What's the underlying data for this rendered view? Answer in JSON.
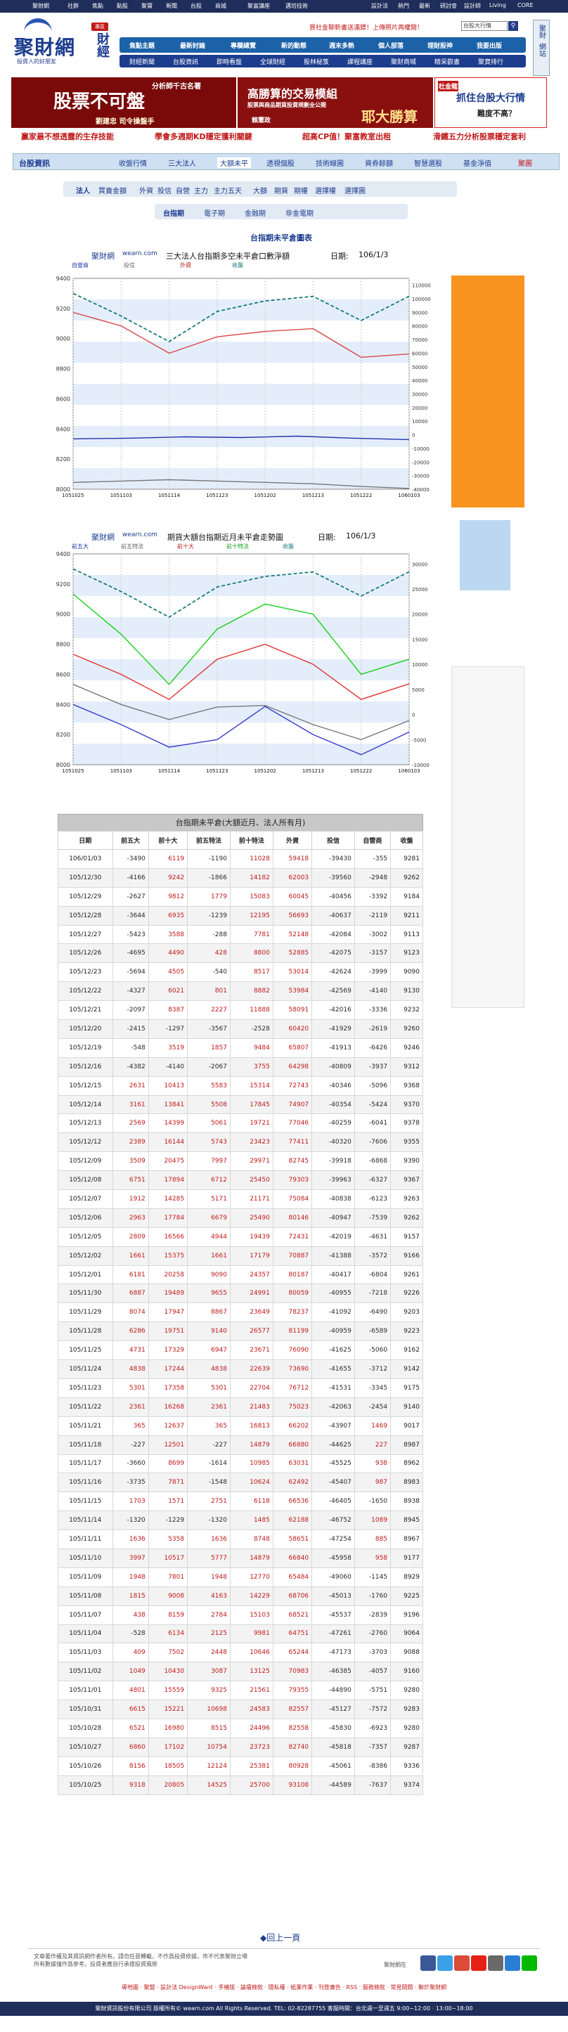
{
  "topnav": [
    "聚財網",
    "社群",
    "焦點",
    "點股",
    "聚寶",
    "新聞",
    "台股",
    "商城",
    "聚富講座",
    "邁培技術",
    "",
    "",
    "設計法",
    "熱門",
    "最新",
    "研討會",
    "設計師",
    "Living",
    "CORE"
  ],
  "logo": {
    "main": "聚財網",
    "side": "財經",
    "sub": "投資人的好朋友"
  },
  "pill": "專區",
  "promo": "買社金聊新書送滿鏢！上傳照片再權閱！",
  "search_placeholder": "台股大行情",
  "search_icon": "search-icon",
  "nav1": [
    "焦點主題",
    "最新討論",
    "專欄總覽",
    "新的動態",
    "週末多熱",
    "個人部落",
    "理財股神",
    "我要出版"
  ],
  "nav2": [
    "財經新聞",
    "台股資訊",
    "即時看盤",
    "全球財經",
    "股林秘笈",
    "課程講座",
    "聚財商城",
    "精采叡書",
    "聚寶排行"
  ],
  "side_right": [
    "聚財",
    "網站"
  ],
  "banner1": {
    "a": "股票不可盤",
    "b": "分析師千古名著",
    "c": "劉建忠 司令操盤手"
  },
  "banner2": {
    "a": "高勝算的交易模組",
    "b": "股票與商品期貨投資規劃全公開",
    "c": "耶大勝算",
    "d": "賴憲政"
  },
  "banner3": {
    "a": "杜金龍",
    "b": "抓住台股大行情",
    "c": "難度不高？"
  },
  "promo_row": [
    "贏家最不想透露的生存技能",
    "學會多週期KD穩定獲利關鍵",
    "超高CP值！聚富教室出租",
    "滑鐵五力分析股票穩定套利"
  ],
  "tabs": [
    "台股資訊",
    "收盤行情",
    "三大法人",
    "大額未平",
    "透視個股",
    "技術線圖",
    "資券餘額",
    "智慧選股",
    "基金淨值",
    "聚圖"
  ],
  "sub1": [
    "法人",
    "買賣金額",
    "外資",
    "投信",
    "自營",
    "主力",
    "主力五天",
    "大額",
    "期貨",
    "期權",
    "選擇權",
    "選擇圖"
  ],
  "sub2": [
    "台指期",
    "電子期",
    "金融期",
    "非金電期"
  ],
  "page_title": "台指期未平倉圖表",
  "chart1": {
    "site": "聚財網",
    "url": "wearn.com",
    "title": "三大法人台指期多空未平倉口數淨額",
    "date_label": "日期:",
    "date": "106/1/3",
    "legend": [
      "自營商",
      "投信",
      "外資",
      "收盤"
    ]
  },
  "chart2": {
    "site": "聚財網",
    "url": "wearn.com",
    "title": "期貨大額台指期近月未平倉走勢圖",
    "date_label": "日期:",
    "date": "106/1/3",
    "legend": [
      "前五大",
      "前五特法",
      "前十大",
      "前十特法",
      "收盤"
    ]
  },
  "chart_data": [
    {
      "type": "line",
      "title": "三大法人台指期多空未平倉口數淨額",
      "x": [
        "1051025",
        "1051103",
        "1051114",
        "1051123",
        "1051202",
        "1051213",
        "1051222",
        "1060103"
      ],
      "ylim": [
        8000,
        9400
      ],
      "y2lim": [
        -40000,
        115000
      ],
      "series": [
        {
          "name": "自營商",
          "values": [
            -3000,
            -2500,
            -1500,
            -2000,
            -1000,
            -2500,
            -3500
          ]
        },
        {
          "name": "投信",
          "values": [
            -35000,
            -34000,
            -33000,
            -34000,
            -35000,
            -36000,
            -38000,
            -39430
          ]
        },
        {
          "name": "外資",
          "values": [
            90000,
            80000,
            60000,
            72000,
            76000,
            78000,
            57000,
            59418
          ]
        },
        {
          "name": "收盤",
          "values": [
            9300,
            9150,
            8980,
            9180,
            9250,
            9280,
            9120,
            9281
          ]
        }
      ]
    },
    {
      "type": "line",
      "title": "期貨大額台指期近月未平倉走勢圖",
      "x": [
        "1051025",
        "1051103",
        "1051114",
        "1051123",
        "1051202",
        "1051213",
        "1051222",
        "1060103"
      ],
      "ylim": [
        8000,
        9400
      ],
      "y2lim": [
        -10000,
        32000
      ],
      "series": [
        {
          "name": "前五大",
          "values": [
            2000,
            -2000,
            -6500,
            -5000,
            1600,
            -4000,
            -8000,
            -3490
          ]
        },
        {
          "name": "前五特法",
          "values": [
            6000,
            2000,
            -1000,
            1500,
            1800,
            -2000,
            -5000,
            -1190
          ]
        },
        {
          "name": "前十大",
          "values": [
            12000,
            8000,
            3000,
            11000,
            14000,
            10000,
            3000,
            6119
          ]
        },
        {
          "name": "前十特法",
          "values": [
            24000,
            16000,
            6000,
            17000,
            22000,
            20000,
            8000,
            11028
          ]
        },
        {
          "name": "收盤",
          "values": [
            9300,
            9150,
            8980,
            9180,
            9250,
            9280,
            9120,
            9281
          ]
        }
      ]
    }
  ],
  "table": {
    "caption": "台指期未平倉(大額近月、法人所有月)",
    "headers": [
      "日期",
      "前五大",
      "前十大",
      "前五特法",
      "前十特法",
      "外資",
      "投信",
      "自營商",
      "收盤"
    ],
    "rows": [
      [
        "106/01/03",
        "-3490",
        "6119",
        "-1190",
        "11028",
        "59418",
        "-39430",
        "-355",
        "9281"
      ],
      [
        "105/12/30",
        "-4166",
        "9242",
        "-1866",
        "14182",
        "62003",
        "-39560",
        "-2948",
        "9262"
      ],
      [
        "105/12/29",
        "-2627",
        "9812",
        "1779",
        "15083",
        "60045",
        "-40456",
        "-3392",
        "9184"
      ],
      [
        "105/12/28",
        "-3644",
        "6935",
        "-1239",
        "12195",
        "56693",
        "-40637",
        "-2119",
        "9211"
      ],
      [
        "105/12/27",
        "-5423",
        "3588",
        "-288",
        "7781",
        "52148",
        "-42084",
        "-3002",
        "9113"
      ],
      [
        "105/12/26",
        "-4695",
        "4490",
        "428",
        "8800",
        "52885",
        "-42075",
        "-3157",
        "9123"
      ],
      [
        "105/12/23",
        "-5694",
        "4505",
        "-540",
        "8517",
        "53014",
        "-42624",
        "-3999",
        "9090"
      ],
      [
        "105/12/22",
        "-4327",
        "6021",
        "801",
        "8882",
        "53984",
        "-42569",
        "-4140",
        "9130"
      ],
      [
        "105/12/21",
        "-2097",
        "8387",
        "2227",
        "11888",
        "58091",
        "-42016",
        "-3336",
        "9232"
      ],
      [
        "105/12/20",
        "-2415",
        "-1297",
        "-3567",
        "-2528",
        "60420",
        "-41929",
        "-2619",
        "9260"
      ],
      [
        "105/12/19",
        "-548",
        "3519",
        "1857",
        "9484",
        "65807",
        "-41913",
        "-6426",
        "9246"
      ],
      [
        "105/12/16",
        "-4382",
        "-4140",
        "-2067",
        "3755",
        "64298",
        "-40809",
        "-3937",
        "9312"
      ],
      [
        "105/12/15",
        "2631",
        "10413",
        "5583",
        "15314",
        "72743",
        "-40346",
        "-5096",
        "9368"
      ],
      [
        "105/12/14",
        "3161",
        "13841",
        "5508",
        "17845",
        "74907",
        "-40354",
        "-5424",
        "9370"
      ],
      [
        "105/12/13",
        "2569",
        "14399",
        "5061",
        "19721",
        "77046",
        "-40259",
        "-6041",
        "9378"
      ],
      [
        "105/12/12",
        "2389",
        "16144",
        "5743",
        "23423",
        "77411",
        "-40320",
        "-7606",
        "9355"
      ],
      [
        "105/12/09",
        "3509",
        "20475",
        "7997",
        "29971",
        "82745",
        "-39918",
        "-6868",
        "9390"
      ],
      [
        "105/12/08",
        "6751",
        "17894",
        "6712",
        "25450",
        "79303",
        "-39963",
        "-6327",
        "9367"
      ],
      [
        "105/12/07",
        "1912",
        "14285",
        "5171",
        "21171",
        "75084",
        "-40838",
        "-6123",
        "9263"
      ],
      [
        "105/12/06",
        "2963",
        "17784",
        "6679",
        "25490",
        "80146",
        "-40947",
        "-7539",
        "9262"
      ],
      [
        "105/12/05",
        "2809",
        "16566",
        "4944",
        "19439",
        "72431",
        "-42019",
        "-4631",
        "9157"
      ],
      [
        "105/12/02",
        "1661",
        "15375",
        "1661",
        "17179",
        "70887",
        "-41388",
        "-3572",
        "9166"
      ],
      [
        "105/12/01",
        "6181",
        "20258",
        "9090",
        "24357",
        "80187",
        "-40417",
        "-6804",
        "9261"
      ],
      [
        "105/11/30",
        "6887",
        "19489",
        "9655",
        "24991",
        "80059",
        "-40955",
        "-7218",
        "9226"
      ],
      [
        "105/11/29",
        "8074",
        "17947",
        "8867",
        "23649",
        "78237",
        "-41092",
        "-6490",
        "9203"
      ],
      [
        "105/11/28",
        "6286",
        "19751",
        "9140",
        "26577",
        "81199",
        "-40959",
        "-6589",
        "9223"
      ],
      [
        "105/11/25",
        "4731",
        "17329",
        "6947",
        "23671",
        "76090",
        "-41625",
        "-5060",
        "9162"
      ],
      [
        "105/11/24",
        "4838",
        "17244",
        "4838",
        "22639",
        "73690",
        "-41655",
        "-3712",
        "9142"
      ],
      [
        "105/11/23",
        "5301",
        "17358",
        "5301",
        "22704",
        "76712",
        "-41531",
        "-3345",
        "9175"
      ],
      [
        "105/11/22",
        "2361",
        "16268",
        "2361",
        "21483",
        "75023",
        "-42063",
        "-2454",
        "9140"
      ],
      [
        "105/11/21",
        "365",
        "12637",
        "365",
        "16813",
        "66202",
        "-43907",
        "1469",
        "9017"
      ],
      [
        "105/11/18",
        "-227",
        "12501",
        "-227",
        "14879",
        "66880",
        "-44625",
        "227",
        "8987"
      ],
      [
        "105/11/17",
        "-3660",
        "8699",
        "-1614",
        "10985",
        "63031",
        "-45525",
        "938",
        "8962"
      ],
      [
        "105/11/16",
        "-3735",
        "7871",
        "-1548",
        "10624",
        "62492",
        "-45407",
        "987",
        "8983"
      ],
      [
        "105/11/15",
        "1703",
        "1571",
        "2751",
        "6118",
        "66536",
        "-46405",
        "-1650",
        "8938"
      ],
      [
        "105/11/14",
        "-1320",
        "-1229",
        "-1320",
        "1485",
        "62188",
        "-46752",
        "1089",
        "8945"
      ],
      [
        "105/11/11",
        "1636",
        "5358",
        "1636",
        "8748",
        "58651",
        "-47254",
        "885",
        "8967"
      ],
      [
        "105/11/10",
        "3997",
        "10517",
        "5777",
        "14879",
        "66840",
        "-45958",
        "958",
        "9177"
      ],
      [
        "105/11/09",
        "1948",
        "7801",
        "1948",
        "12770",
        "65484",
        "-49060",
        "-1145",
        "8929"
      ],
      [
        "105/11/08",
        "1815",
        "9008",
        "4163",
        "14229",
        "68706",
        "-45013",
        "-1760",
        "9225"
      ],
      [
        "105/11/07",
        "438",
        "8159",
        "2784",
        "15103",
        "68521",
        "-45537",
        "-2839",
        "9196"
      ],
      [
        "105/11/04",
        "-528",
        "6134",
        "2125",
        "9981",
        "64751",
        "-47261",
        "-2760",
        "9064"
      ],
      [
        "105/11/03",
        "409",
        "7502",
        "2448",
        "10646",
        "65244",
        "-47173",
        "-3703",
        "9088"
      ],
      [
        "105/11/02",
        "1049",
        "10430",
        "3087",
        "13125",
        "70983",
        "-46385",
        "-4057",
        "9160"
      ],
      [
        "105/11/01",
        "4801",
        "15559",
        "9325",
        "21561",
        "79355",
        "-44890",
        "-5751",
        "9280"
      ],
      [
        "105/10/31",
        "6615",
        "15221",
        "10698",
        "24583",
        "82557",
        "-45127",
        "-7572",
        "9283"
      ],
      [
        "105/10/28",
        "6521",
        "16980",
        "8515",
        "24496",
        "82558",
        "-45830",
        "-6923",
        "9280"
      ],
      [
        "105/10/27",
        "6860",
        "17102",
        "10754",
        "23723",
        "82740",
        "-45818",
        "-7357",
        "9287"
      ],
      [
        "105/10/26",
        "8156",
        "18505",
        "12124",
        "25381",
        "80928",
        "-45061",
        "-8386",
        "9336"
      ],
      [
        "105/10/25",
        "9318",
        "20805",
        "14525",
        "25700",
        "93108",
        "-44589",
        "-7637",
        "9374"
      ]
    ]
  },
  "back_link": "回上一頁",
  "footer_text": [
    "文章著作權及其資訊網作者所有。請勿任意轉載，不作爲投資依據，市不代表聚財立場",
    "所有數據僅作爲參考。投資者應自行承擔投資風險"
  ],
  "social_label": "聚財網在",
  "footer_links": "導地圖 ‧ 聚盟 ‧ 設計法 DesignWant ‧ 手機版 ‧ 論壇條款 ‧ 隱私權 ‧ 紙業作業 ‧ 刊登廣告 ‧ RSS ‧ 服務條款 ‧ 常見問題 ‧ 聯於聚財網",
  "copyright": "聚財資訊股份有限公司 版權所有© wearn.com All Rights Reserved. TEL: 02-82287755 客服時間：台北週一至週五 9:00~12:00 · 13:00~18:00"
}
